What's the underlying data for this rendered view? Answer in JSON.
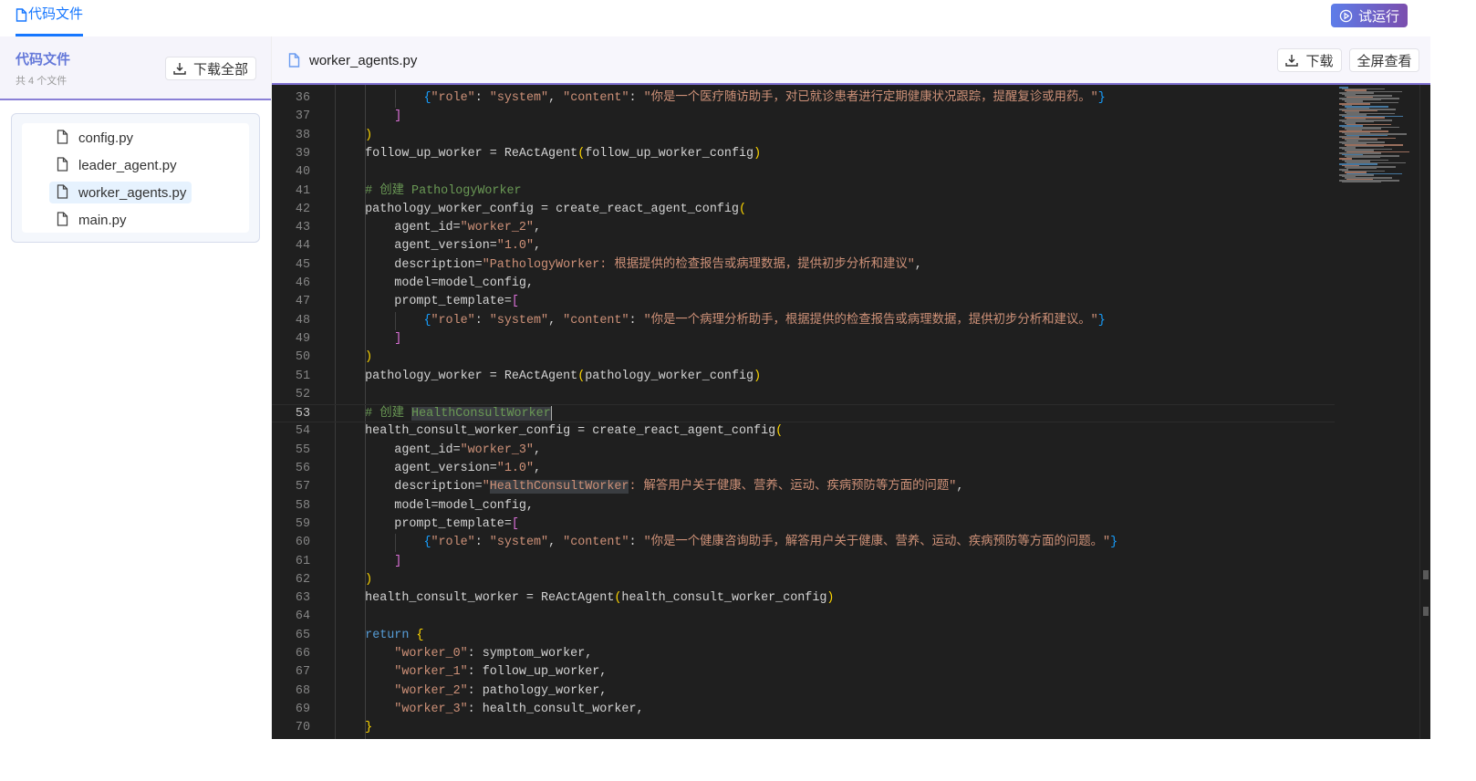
{
  "topbar": {
    "tab_label": "代码文件",
    "run_label": "试运行"
  },
  "sidebar": {
    "title": "代码文件",
    "subtitle": "共 4 个文件",
    "download_all_label": "下载全部",
    "files": [
      {
        "name": "config.py"
      },
      {
        "name": "leader_agent.py"
      },
      {
        "name": "worker_agents.py",
        "active": true
      },
      {
        "name": "main.py"
      }
    ]
  },
  "editor": {
    "filename": "worker_agents.py",
    "download_label": "下载",
    "fullscreen_label": "全屏查看",
    "current_line": 53,
    "colors": {
      "background": "#1f1f1f",
      "keyword": "#569cd6",
      "string": "#ce9178",
      "comment": "#6a9955",
      "paren": "#ffd700",
      "bracket": "#da70d6",
      "brace": "#179fff"
    },
    "lines": [
      {
        "n": 36,
        "t": [
          [
            "",
            "            "
          ],
          [
            "p3",
            "{"
          ],
          [
            "str",
            "\"role\""
          ],
          [
            "",
            ": "
          ],
          [
            "str",
            "\"system\""
          ],
          [
            "",
            ", "
          ],
          [
            "str",
            "\"content\""
          ],
          [
            "",
            ": "
          ],
          [
            "str",
            "\"你是一个医疗随访助手，对已就诊患者进行定期健康状况跟踪，提醒复诊或用药。\""
          ],
          [
            "p3",
            "}"
          ]
        ]
      },
      {
        "n": 37,
        "t": [
          [
            "",
            "        "
          ],
          [
            "p2",
            "]"
          ]
        ]
      },
      {
        "n": 38,
        "t": [
          [
            "",
            "    "
          ],
          [
            "p1",
            ")"
          ]
        ]
      },
      {
        "n": 39,
        "t": [
          [
            "",
            "    follow_up_worker = ReActAgent"
          ],
          [
            "p1",
            "("
          ],
          [
            "",
            "follow_up_worker_config"
          ],
          [
            "p1",
            ")"
          ]
        ]
      },
      {
        "n": 40,
        "t": []
      },
      {
        "n": 41,
        "t": [
          [
            "",
            "    "
          ],
          [
            "com",
            "# 创建 PathologyWorker"
          ]
        ]
      },
      {
        "n": 42,
        "t": [
          [
            "",
            "    pathology_worker_config = create_react_agent_config"
          ],
          [
            "p1",
            "("
          ]
        ]
      },
      {
        "n": 43,
        "t": [
          [
            "",
            "        agent_id="
          ],
          [
            "str",
            "\"worker_2\""
          ],
          [
            "",
            ","
          ]
        ]
      },
      {
        "n": 44,
        "t": [
          [
            "",
            "        agent_version="
          ],
          [
            "str",
            "\"1.0\""
          ],
          [
            "",
            ","
          ]
        ]
      },
      {
        "n": 45,
        "t": [
          [
            "",
            "        description="
          ],
          [
            "str",
            "\"PathologyWorker: 根据提供的检查报告或病理数据，提供初步分析和建议\""
          ],
          [
            "",
            ","
          ]
        ]
      },
      {
        "n": 46,
        "t": [
          [
            "",
            "        model=model_config,"
          ]
        ]
      },
      {
        "n": 47,
        "t": [
          [
            "",
            "        prompt_template="
          ],
          [
            "p2",
            "["
          ]
        ]
      },
      {
        "n": 48,
        "t": [
          [
            "",
            "            "
          ],
          [
            "p3",
            "{"
          ],
          [
            "str",
            "\"role\""
          ],
          [
            "",
            ": "
          ],
          [
            "str",
            "\"system\""
          ],
          [
            "",
            ", "
          ],
          [
            "str",
            "\"content\""
          ],
          [
            "",
            ": "
          ],
          [
            "str",
            "\"你是一个病理分析助手，根据提供的检查报告或病理数据，提供初步分析和建议。\""
          ],
          [
            "p3",
            "}"
          ]
        ]
      },
      {
        "n": 49,
        "t": [
          [
            "",
            "        "
          ],
          [
            "p2",
            "]"
          ]
        ]
      },
      {
        "n": 50,
        "t": [
          [
            "",
            "    "
          ],
          [
            "p1",
            ")"
          ]
        ]
      },
      {
        "n": 51,
        "t": [
          [
            "",
            "    pathology_worker = ReActAgent"
          ],
          [
            "p1",
            "("
          ],
          [
            "",
            "pathology_worker_config"
          ],
          [
            "p1",
            ")"
          ]
        ]
      },
      {
        "n": 52,
        "t": []
      },
      {
        "n": 53,
        "t": [
          [
            "",
            "    "
          ],
          [
            "com",
            "# 创建 "
          ],
          [
            "hlc",
            "HealthConsultWorker"
          ],
          [
            "cursor",
            ""
          ]
        ]
      },
      {
        "n": 54,
        "t": [
          [
            "",
            "    health_consult_worker_config = create_react_agent_config"
          ],
          [
            "p1",
            "("
          ]
        ]
      },
      {
        "n": 55,
        "t": [
          [
            "",
            "        agent_id="
          ],
          [
            "str",
            "\"worker_3\""
          ],
          [
            "",
            ","
          ]
        ]
      },
      {
        "n": 56,
        "t": [
          [
            "",
            "        agent_version="
          ],
          [
            "str",
            "\"1.0\""
          ],
          [
            "",
            ","
          ]
        ]
      },
      {
        "n": 57,
        "t": [
          [
            "",
            "        description="
          ],
          [
            "str",
            "\""
          ],
          [
            "hls",
            "HealthConsultWorker"
          ],
          [
            "str",
            ": 解答用户关于健康、营养、运动、疾病预防等方面的问题\""
          ],
          [
            "",
            ","
          ]
        ]
      },
      {
        "n": 58,
        "t": [
          [
            "",
            "        model=model_config,"
          ]
        ]
      },
      {
        "n": 59,
        "t": [
          [
            "",
            "        prompt_template="
          ],
          [
            "p2",
            "["
          ]
        ]
      },
      {
        "n": 60,
        "t": [
          [
            "",
            "            "
          ],
          [
            "p3",
            "{"
          ],
          [
            "str",
            "\"role\""
          ],
          [
            "",
            ": "
          ],
          [
            "str",
            "\"system\""
          ],
          [
            "",
            ", "
          ],
          [
            "str",
            "\"content\""
          ],
          [
            "",
            ": "
          ],
          [
            "str",
            "\"你是一个健康咨询助手，解答用户关于健康、营养、运动、疾病预防等方面的问题。\""
          ],
          [
            "p3",
            "}"
          ]
        ]
      },
      {
        "n": 61,
        "t": [
          [
            "",
            "        "
          ],
          [
            "p2",
            "]"
          ]
        ]
      },
      {
        "n": 62,
        "t": [
          [
            "",
            "    "
          ],
          [
            "p1",
            ")"
          ]
        ]
      },
      {
        "n": 63,
        "t": [
          [
            "",
            "    health_consult_worker = ReActAgent"
          ],
          [
            "p1",
            "("
          ],
          [
            "",
            "health_consult_worker_config"
          ],
          [
            "p1",
            ")"
          ]
        ]
      },
      {
        "n": 64,
        "t": []
      },
      {
        "n": 65,
        "t": [
          [
            "",
            "    "
          ],
          [
            "kw",
            "return"
          ],
          [
            "",
            " "
          ],
          [
            "p1",
            "{"
          ]
        ]
      },
      {
        "n": 66,
        "t": [
          [
            "",
            "        "
          ],
          [
            "str",
            "\"worker_0\""
          ],
          [
            "",
            ": symptom_worker,"
          ]
        ]
      },
      {
        "n": 67,
        "t": [
          [
            "",
            "        "
          ],
          [
            "str",
            "\"worker_1\""
          ],
          [
            "",
            ": follow_up_worker,"
          ]
        ]
      },
      {
        "n": 68,
        "t": [
          [
            "",
            "        "
          ],
          [
            "str",
            "\"worker_2\""
          ],
          [
            "",
            ": pathology_worker,"
          ]
        ]
      },
      {
        "n": 69,
        "t": [
          [
            "",
            "        "
          ],
          [
            "str",
            "\"worker_3\""
          ],
          [
            "",
            ": health_consult_worker,"
          ]
        ]
      },
      {
        "n": 70,
        "t": [
          [
            "",
            "    "
          ],
          [
            "p1",
            "}"
          ]
        ]
      }
    ]
  }
}
